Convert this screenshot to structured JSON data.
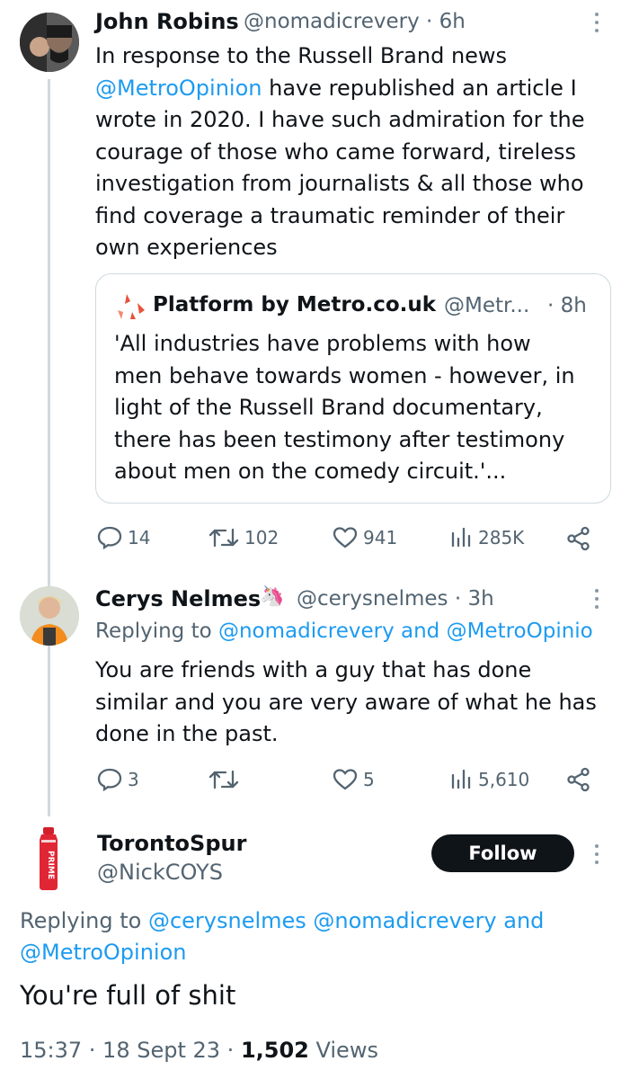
{
  "tweet1": {
    "name": "John Robins",
    "handle": "@nomadicrevery",
    "time": "· 6h",
    "text_lines": [
      "In response to the Russell Brand news",
      "have republished an article I",
      "wrote in 2020. I have such admiration for the",
      "courage of those who came forward, tireless",
      "investigation from journalists & all those who",
      "find coverage a traumatic reminder of their",
      "own experiences"
    ],
    "mention": "@MetroOpinion",
    "quote": {
      "name": "Platform by Metro.co.uk",
      "handle": "@Metr...",
      "time": "· 8h",
      "lines": [
        "'All industries have problems with how",
        "men behave towards women - however, in",
        "light of the Russell Brand documentary,",
        "there has been testimony after testimony",
        "about men on the comedy circuit.'..."
      ]
    },
    "replies": "14",
    "retweets": "102",
    "likes": "941",
    "views": "285K"
  },
  "tweet2": {
    "name": "Cerys Nelmes",
    "emoji": "🦄",
    "handle": "@cerysnelmes",
    "time": "· 3h",
    "replying_prefix": "Replying to",
    "replying_to": "@nomadicrevery and @MetroOpinio",
    "text_lines": [
      "You are friends with a guy that has done",
      "similar and you are very aware of what he has",
      "done in the past."
    ],
    "replies": "3",
    "retweets": "",
    "likes": "5",
    "views": "5,610"
  },
  "tweet3": {
    "name": "TorontoSpur",
    "handle": "@NickCOYS",
    "avatar_text": "PRIME",
    "follow_label": "Follow",
    "replying_prefix": "Replying to",
    "replying_line1": "@cerysnelmes @nomadicrevery and",
    "replying_line2": "@MetroOpinion",
    "text": "You're full of shit",
    "timestamp": "15:37 · 18 Sept 23 ·",
    "views_count": "1,502",
    "views_label": "Views"
  },
  "colors": {
    "link": "#1d9bf0",
    "secondary_text": "#536471",
    "follow_button": "#0f1419",
    "border": "#cfd9de"
  }
}
